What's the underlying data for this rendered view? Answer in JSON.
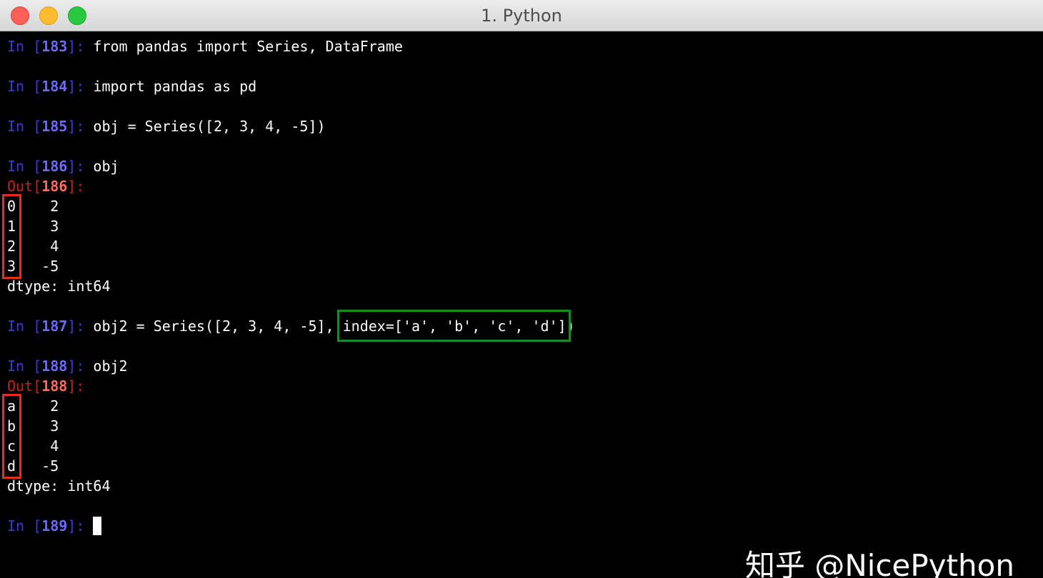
{
  "window": {
    "title": "1. Python"
  },
  "terminal": {
    "cells": [
      {
        "in": "In [",
        "num": "183",
        "close": "]: ",
        "code": "from pandas import Series, DataFrame"
      },
      {
        "in": "In [",
        "num": "184",
        "close": "]: ",
        "code": "import pandas as pd"
      },
      {
        "in": "In [",
        "num": "185",
        "close": "]: ",
        "code": "obj = Series([2, 3, 4, -5])"
      },
      {
        "in": "In [",
        "num": "186",
        "close": "]: ",
        "code": "obj"
      },
      {
        "in": "In [",
        "num": "187",
        "close": "]: ",
        "code": "obj2 = Series([2, 3, 4, -5], index=['a', 'b', 'c', 'd'])"
      },
      {
        "in": "In [",
        "num": "188",
        "close": "]: ",
        "code": "obj2"
      },
      {
        "in": "In [",
        "num": "189",
        "close": "]: ",
        "code": ""
      }
    ],
    "outputs": [
      {
        "out": "Out[",
        "num": "186",
        "close": "]:"
      },
      {
        "out": "Out[",
        "num": "188",
        "close": "]:"
      }
    ],
    "series1": [
      "0    2",
      "1    3",
      "2    4",
      "3   -5"
    ],
    "series1_dtype": "dtype: int64",
    "series2": [
      "a    2",
      "b    3",
      "c    4",
      "d   -5"
    ],
    "series2_dtype": "dtype: int64"
  },
  "watermark": {
    "text": "知乎 @NicePython"
  }
}
